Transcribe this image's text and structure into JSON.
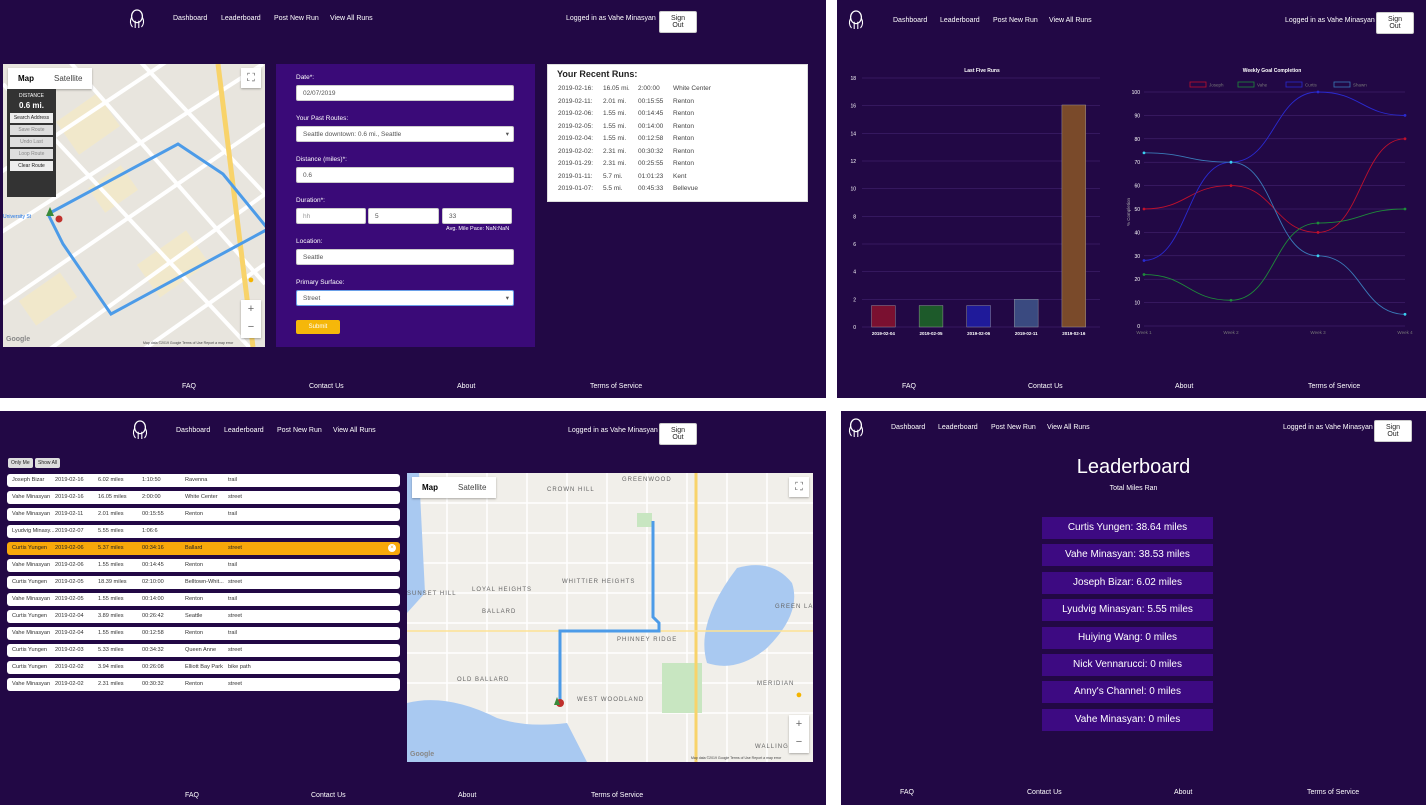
{
  "header": {
    "nav": [
      "Dashboard",
      "Leaderboard",
      "Post New Run",
      "View All Runs"
    ],
    "logged_in": "Logged in as Vahe Minasyan",
    "sign_out": "Sign Out"
  },
  "footer": [
    "FAQ",
    "Contact Us",
    "About",
    "Terms of Service"
  ],
  "map": {
    "tab_map": "Map",
    "tab_satellite": "Satellite",
    "attrib1": "Map data ©2019 Google   Terms of Use   Report a map error",
    "google": "Google"
  },
  "post_run": {
    "distance_panel": {
      "label": "DISTANCE",
      "value": "0.6 mi."
    },
    "tools": [
      "Search Address",
      "Save Route",
      "Undo Last",
      "Loop Route",
      "Clear Route"
    ],
    "date_label": "Date*:",
    "date_value": "02/07/2019",
    "routes_label": "Your Past Routes:",
    "routes_value": "Seattle downtown: 0.6 mi., Seattle",
    "distance_label": "Distance (miles)*:",
    "distance_value": "0.6",
    "duration_label": "Duration*:",
    "duration_h": "hh",
    "duration_m": "5",
    "duration_s": "33",
    "pace": "Avg. Mile Pace: NaN:NaN",
    "location_label": "Location:",
    "location_value": "Seattle",
    "surface_label": "Primary Surface:",
    "surface_value": "Street",
    "submit": "Submit",
    "recent_title": "Your Recent Runs:",
    "recent_runs": [
      [
        "2019-02-16:",
        "16.05 mi.",
        "2:00:00",
        "White Center"
      ],
      [
        "2019-02-11:",
        "2.01 mi.",
        "00:15:55",
        "Renton"
      ],
      [
        "2019-02-06:",
        "1.55 mi.",
        "00:14:45",
        "Renton"
      ],
      [
        "2019-02-05:",
        "1.55 mi.",
        "00:14:00",
        "Renton"
      ],
      [
        "2019-02-04:",
        "1.55 mi.",
        "00:12:58",
        "Renton"
      ],
      [
        "2019-02-02:",
        "2.31 mi.",
        "00:30:32",
        "Renton"
      ],
      [
        "2019-01-29:",
        "2.31 mi.",
        "00:25:55",
        "Renton"
      ],
      [
        "2019-01-11:",
        "5.7 mi.",
        "01:01:23",
        "Kent"
      ],
      [
        "2019-01-07:",
        "5.5 mi.",
        "00:45:33",
        "Bellevue"
      ]
    ]
  },
  "dashboard": {
    "bar_title": "Last Five Runs",
    "line_title": "Weekly Goal Completion",
    "line_ylabel": "% Completion"
  },
  "chart_data": [
    {
      "type": "bar",
      "title": "Last Five Runs",
      "categories": [
        "2019-02-04",
        "2019-02-05",
        "2019-02-06",
        "2019-02-11",
        "2019-02-16"
      ],
      "values": [
        1.55,
        1.55,
        1.55,
        2.01,
        16.05
      ],
      "colors": [
        "#7a1030",
        "#1d5a2a",
        "#1f1a9a",
        "#3a4a80",
        "#7a4a2a"
      ],
      "ylim": [
        0,
        18
      ],
      "yticks": [
        0,
        2,
        4,
        6,
        8,
        10,
        12,
        14,
        16,
        18
      ]
    },
    {
      "type": "line",
      "title": "Weekly Goal Completion",
      "ylabel": "% Completion",
      "categories": [
        "Week 1",
        "Week 2",
        "Week 3",
        "Week 4"
      ],
      "ylim": [
        0,
        100
      ],
      "yticks": [
        0,
        10,
        20,
        30,
        40,
        50,
        60,
        70,
        80,
        90,
        100
      ],
      "series": [
        {
          "name": "Joseph",
          "color": "#c0102c",
          "values": [
            50,
            60,
            40,
            80
          ]
        },
        {
          "name": "Vahe",
          "color": "#1e8a3a",
          "values": [
            22,
            11,
            44,
            50
          ]
        },
        {
          "name": "Curtis",
          "color": "#2a2ad0",
          "values": [
            28,
            70,
            100,
            90
          ]
        },
        {
          "name": "Shawn",
          "color": "#3a7ab8",
          "values": [
            74,
            70,
            30,
            5
          ]
        }
      ]
    }
  ],
  "all_runs": {
    "only_me": "Only Me",
    "show_all": "Show All",
    "rows": [
      [
        "Joseph Bizar",
        "2019-02-16",
        "6.02 miles",
        "1:10:50",
        "Ravenna",
        "trail"
      ],
      [
        "Vahe Minasyan",
        "2019-02-16",
        "16.05 miles",
        "2:00:00",
        "White Center",
        "street"
      ],
      [
        "Vahe Minasyan",
        "2019-02-11",
        "2.01 miles",
        "00:15:55",
        "Renton",
        "trail"
      ],
      [
        "Lyudvig Minasy...",
        "2019-02-07",
        "5.55 miles",
        "1:06:6",
        "",
        ""
      ],
      [
        "Curtis Yungen",
        "2019-02-06",
        "5.37 miles",
        "00:34:16",
        "Ballard",
        "street"
      ],
      [
        "Vahe Minasyan",
        "2019-02-06",
        "1.55 miles",
        "00:14:45",
        "Renton",
        "trail"
      ],
      [
        "Curtis Yungen",
        "2019-02-05",
        "18.39 miles",
        "02:10:00",
        "Belltown-Whit...",
        "street"
      ],
      [
        "Vahe Minasyan",
        "2019-02-05",
        "1.55 miles",
        "00:14:00",
        "Renton",
        "trail"
      ],
      [
        "Curtis Yungen",
        "2019-02-04",
        "3.89 miles",
        "00:26:42",
        "Seattle",
        "street"
      ],
      [
        "Vahe Minasyan",
        "2019-02-04",
        "1.55 miles",
        "00:12:58",
        "Renton",
        "trail"
      ],
      [
        "Curtis Yungen",
        "2019-02-03",
        "5.33 miles",
        "00:34:32",
        "Queen Anne",
        "street"
      ],
      [
        "Curtis Yungen",
        "2019-02-02",
        "3.94 miles",
        "00:26:08",
        "Elliott Bay Park",
        "bike path"
      ],
      [
        "Vahe Minasyan",
        "2019-02-02",
        "2.31 miles",
        "00:30:32",
        "Renton",
        "street"
      ]
    ],
    "selected_index": 4,
    "map_labels": [
      "CROWN HILL",
      "GREENWOOD",
      "WHITTIER HEIGHTS",
      "LOYAL HEIGHTS",
      "BALLARD",
      "PHINNEY RIDGE",
      "OLD BALLARD",
      "WEST WOODLAND",
      "MERIDIAN",
      "GREEN LA",
      "WALLING",
      "SUNSET HILL"
    ]
  },
  "leaderboard": {
    "title": "Leaderboard",
    "subtitle": "Total Miles Ran",
    "entries": [
      "Curtis Yungen: 38.64 miles",
      "Vahe Minasyan: 38.53 miles",
      "Joseph Bizar: 6.02 miles",
      "Lyudvig Minasyan: 5.55 miles",
      "Huiying Wang: 0 miles",
      "Nick Vennarucci: 0 miles",
      "Anny's Channel: 0 miles",
      "Vahe Minasyan: 0 miles"
    ]
  }
}
